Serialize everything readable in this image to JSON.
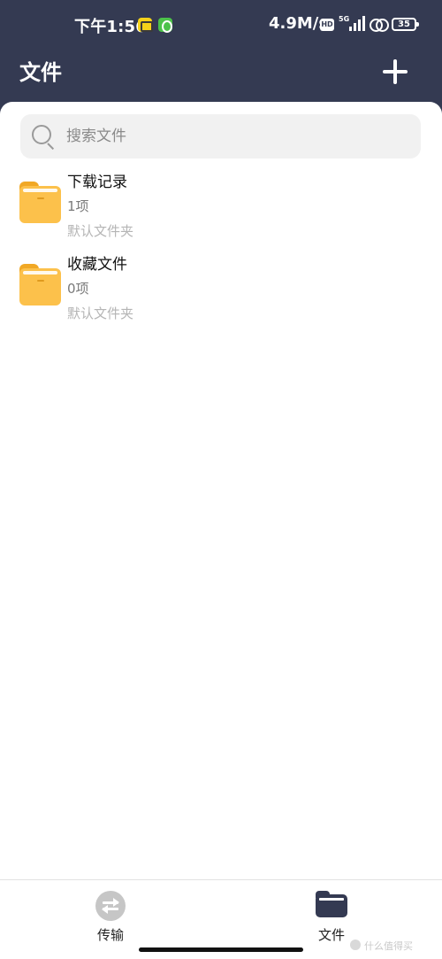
{
  "status_bar": {
    "time": "下午1:56",
    "network_speed": "4.9M/s",
    "hd_label": "HD",
    "signal_label": "5G",
    "battery": "35"
  },
  "header": {
    "title": "文件",
    "add_icon": "plus-icon"
  },
  "search": {
    "placeholder": "搜索文件",
    "value": "",
    "icon": "search-icon"
  },
  "folders": [
    {
      "name": "下载记录",
      "count": "1项",
      "type": "默认文件夹",
      "icon": "folder-icon"
    },
    {
      "name": "收藏文件",
      "count": "0项",
      "type": "默认文件夹",
      "icon": "folder-icon"
    }
  ],
  "bottom_nav": {
    "items": [
      {
        "label": "传输",
        "icon": "transfer-icon",
        "active": false
      },
      {
        "label": "文件",
        "icon": "folder-icon",
        "active": true
      }
    ]
  },
  "watermark": "什么值得买",
  "colors": {
    "header_bg": "#343a52",
    "folder": "#fcc14b",
    "active_nav": "#343a52"
  }
}
